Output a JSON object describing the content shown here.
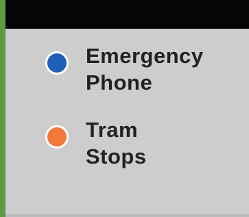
{
  "legend": {
    "items": [
      {
        "icon": "blue-circle-icon",
        "color": "#1f5fb8",
        "label": "Emergency\nPhone"
      },
      {
        "icon": "orange-circle-icon",
        "color": "#f0783a",
        "label": "Tram\nStops"
      }
    ]
  },
  "colors": {
    "panel": "#cdcdcd",
    "top_bar": "#050505",
    "map_edge": "#5f9a45",
    "text": "#222222"
  }
}
